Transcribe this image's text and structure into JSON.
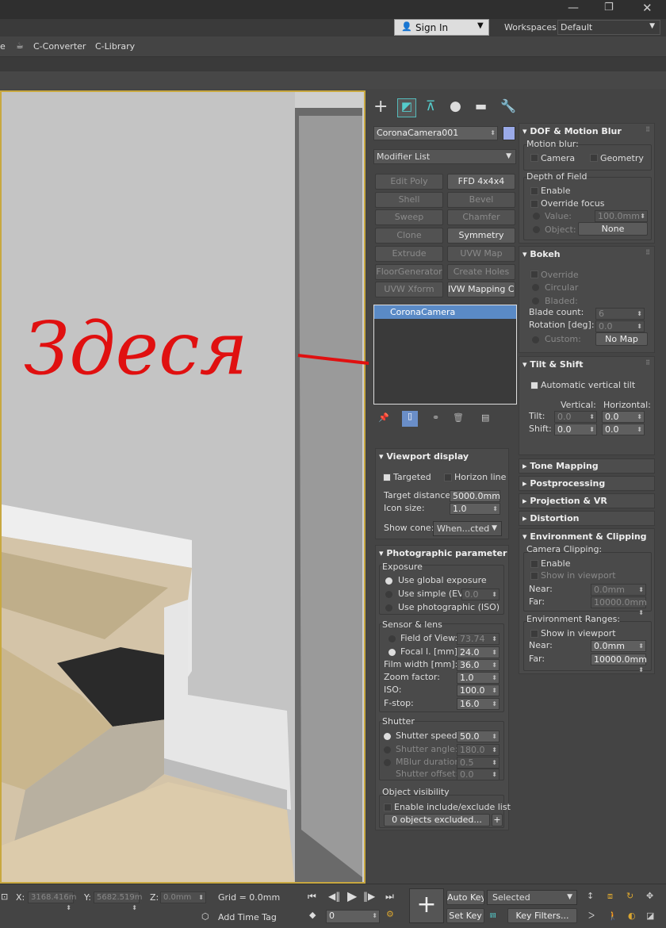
{
  "titlebar": {
    "restore_icon": "restore-icon",
    "close_icon": "close-icon"
  },
  "account": {
    "sign_in": "Sign In",
    "workspaces_label": "Workspaces:",
    "workspace_value": "Default"
  },
  "menu": {
    "item_e": "e",
    "converter": "C-Converter",
    "library": "C-Library"
  },
  "annotation": {
    "text": "Здеся",
    "color": "#e01010"
  },
  "command_panel": {
    "tabs": [
      "create",
      "modify",
      "hierarchy",
      "motion",
      "display",
      "utilities"
    ],
    "object_name": "CoronaCamera001",
    "object_color": "#9aaae8",
    "modifier_list": "Modifier List",
    "modifier_buttons": [
      {
        "label": "Edit Poly",
        "enabled": false
      },
      {
        "label": "FFD 4x4x4",
        "enabled": true
      },
      {
        "label": "Shell",
        "enabled": false
      },
      {
        "label": "Bevel",
        "enabled": false
      },
      {
        "label": "Sweep",
        "enabled": false
      },
      {
        "label": "Chamfer",
        "enabled": false
      },
      {
        "label": "Clone",
        "enabled": false
      },
      {
        "label": "Symmetry",
        "enabled": true
      },
      {
        "label": "Extrude",
        "enabled": false
      },
      {
        "label": "UVW Map",
        "enabled": false
      },
      {
        "label": "FloorGenerator",
        "enabled": false
      },
      {
        "label": "Create Holes",
        "enabled": false
      },
      {
        "label": "UVW Xform",
        "enabled": false
      },
      {
        "label": "IVW Mapping Clea",
        "enabled": true
      }
    ],
    "stack_item": "CoronaCamera",
    "viewport_display": {
      "title": "Viewport display",
      "targeted": "Targeted",
      "horizon_line": "Horizon line",
      "target_distance_label": "Target distance:",
      "target_distance": "5000.0mm",
      "icon_size_label": "Icon size:",
      "icon_size": "1.0",
      "show_cone_label": "Show cone:",
      "show_cone": "When...cted"
    },
    "photographic": {
      "title": "Photographic parameter",
      "exposure": "Exposure",
      "use_global": "Use global exposure",
      "use_simple": "Use simple (EV)",
      "simple_value": "0.0",
      "use_photographic": "Use photographic (ISO)",
      "sensor": "Sensor & lens",
      "fov_label": "Field of View:",
      "fov": "73.74",
      "focal_label": "Focal l. [mm]:",
      "focal": "24.0",
      "film_label": "Film width [mm]:",
      "film": "36.0",
      "zoom_label": "Zoom factor:",
      "zoom": "1.0",
      "iso_label": "ISO:",
      "iso": "100.0",
      "fstop_label": "F-stop:",
      "fstop": "16.0",
      "shutter": "Shutter",
      "speed_label": "Shutter speed:",
      "speed": "50.0",
      "angle_label": "Shutter angle:",
      "angle": "180.0",
      "mblur_label": "MBlur duration:",
      "mblur": "0.5",
      "offset_label": "Shutter offset:",
      "offset": "0.0",
      "visibility": "Object visibility",
      "include_exclude": "Enable include/exclude list",
      "excluded": "0 objects excluded...",
      "add": "+"
    }
  },
  "right_panel": {
    "dof": {
      "title": "DOF & Motion Blur",
      "motion_blur": "Motion blur:",
      "camera": "Camera",
      "geometry": "Geometry",
      "depth_of_field": "Depth of Field",
      "enable": "Enable",
      "override_focus": "Override focus",
      "value_label": "Value:",
      "value": "100.0mm",
      "object_label": "Object:",
      "object": "None"
    },
    "bokeh": {
      "title": "Bokeh",
      "override": "Override",
      "circular": "Circular",
      "bladed": "Bladed:",
      "blade_count_label": "Blade count:",
      "blade_count": "6",
      "rotation_label": "Rotation [deg]:",
      "rotation": "0.0",
      "custom": "Custom:",
      "no_map": "No Map"
    },
    "tilt": {
      "title": "Tilt & Shift",
      "auto": "Automatic vertical tilt",
      "vertical": "Vertical:",
      "horizontal": "Horizontal:",
      "tilt_label": "Tilt:",
      "tilt_v": "0.0",
      "tilt_h": "0.0",
      "shift_label": "Shift:",
      "shift_v": "0.0",
      "shift_h": "0.0"
    },
    "collapsed": [
      "Tone Mapping",
      "Postprocessing",
      "Projection & VR",
      "Distortion"
    ],
    "env": {
      "title": "Environment & Clipping",
      "camera_clipping": "Camera Clipping:",
      "enable": "Enable",
      "show_in_viewport": "Show in viewport",
      "near_label": "Near:",
      "near": "0.0mm",
      "far_label": "Far:",
      "far": "10000.0mm",
      "env_ranges": "Environment Ranges:",
      "show_in_viewport2": "Show in viewport",
      "near2": "0.0mm",
      "far2": "10000.0mm"
    }
  },
  "status": {
    "x_label": "X:",
    "x": "3168.416m",
    "y_label": "Y:",
    "y": "5682.519m",
    "z_label": "Z:",
    "z": "0.0mm",
    "grid": "Grid = 0.0mm",
    "add_time_tag": "Add Time Tag",
    "frame": "0",
    "auto_key": "Auto Key",
    "set_key": "Set Key",
    "selected": "Selected",
    "key_filters": "Key Filters..."
  }
}
